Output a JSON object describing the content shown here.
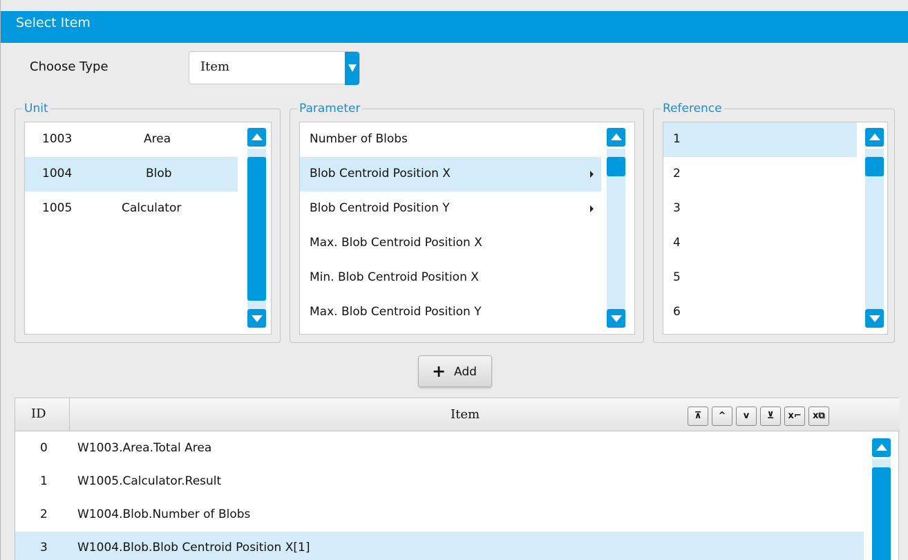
{
  "window": {
    "title": "Select Item"
  },
  "choose_type": {
    "label": "Choose Type",
    "value": "Item"
  },
  "unit": {
    "legend": "Unit",
    "items": [
      {
        "id": "1003",
        "name": "Area"
      },
      {
        "id": "1004",
        "name": "Blob",
        "selected": true
      },
      {
        "id": "1005",
        "name": "Calculator"
      }
    ]
  },
  "parameter": {
    "legend": "Parameter",
    "items": [
      {
        "label": "Number of Blobs"
      },
      {
        "label": "Blob Centroid Position X",
        "selected": true,
        "submenu": true
      },
      {
        "label": "Blob Centroid Position Y",
        "submenu": true
      },
      {
        "label": "Max. Blob Centroid Position X"
      },
      {
        "label": "Min. Blob Centroid Position X"
      },
      {
        "label": "Max. Blob Centroid Position Y"
      }
    ]
  },
  "reference": {
    "legend": "Reference",
    "items": [
      {
        "label": "1",
        "selected": true
      },
      {
        "label": "2"
      },
      {
        "label": "3"
      },
      {
        "label": "4"
      },
      {
        "label": "5"
      },
      {
        "label": "6"
      }
    ]
  },
  "add_button": {
    "label": "Add",
    "icon": "plus-icon"
  },
  "table": {
    "columns": [
      "ID",
      "Item"
    ],
    "toolbar": [
      {
        "name": "move-to-top-icon",
        "glyph": "⊼"
      },
      {
        "name": "move-up-icon",
        "glyph": "^"
      },
      {
        "name": "move-down-icon",
        "glyph": "v"
      },
      {
        "name": "move-to-bottom-icon",
        "glyph": "⊻"
      },
      {
        "name": "delete-item-icon",
        "glyph": "x⌐"
      },
      {
        "name": "delete-all-icon",
        "glyph": "x⧉"
      }
    ],
    "rows": [
      {
        "id": "0",
        "item": "W1003.Area.Total Area"
      },
      {
        "id": "1",
        "item": "W1005.Calculator.Result"
      },
      {
        "id": "2",
        "item": "W1004.Blob.Number of Blobs"
      },
      {
        "id": "3",
        "item": "W1004.Blob.Blob Centroid Position X[1]",
        "selected": true
      }
    ]
  },
  "colors": {
    "accent": "#0099dd",
    "selection": "#d4ebf9",
    "legend": "#1e8cd2"
  }
}
